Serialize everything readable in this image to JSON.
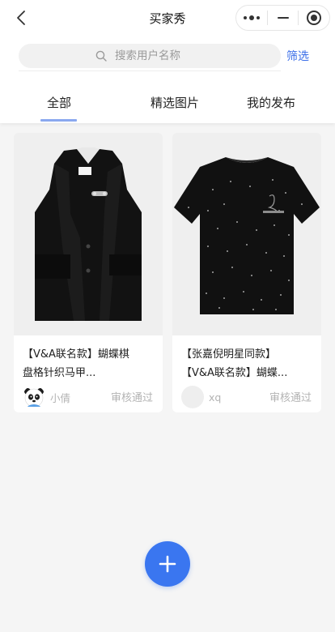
{
  "navbar": {
    "title": "买家秀",
    "back_icon": "chevron-left-icon",
    "capsule_icons": [
      "more-dots-icon",
      "minimize-icon",
      "close-target-icon"
    ]
  },
  "search": {
    "placeholder": "搜索用户名称",
    "icon": "search-icon",
    "filter_label": "筛选"
  },
  "tabs": [
    {
      "label": "全部",
      "active": true
    },
    {
      "label": "精选图片",
      "active": false
    },
    {
      "label": "我的发布",
      "active": false
    }
  ],
  "cards": [
    {
      "image": "black-sleeveless-vest-photo",
      "title_line1": "【V&A联名款】蝴蝶棋",
      "title_line2": "盘格针织马甲...",
      "user": "小倩",
      "avatar": "panda-avatar-icon",
      "status": "审核通过"
    },
    {
      "image": "black-studded-tshirt-photo",
      "title_line1": "【张嘉倪明星同款】",
      "title_line2": "【V&A联名款】蝴蝶...",
      "user": "xq",
      "avatar": "blank-avatar",
      "status": "审核通过"
    }
  ],
  "fab": {
    "icon": "plus-icon"
  },
  "colors": {
    "accent": "#3a6ee8",
    "fab": "#3a76f0",
    "tab_indicator": "#8aa8ef",
    "page_bg": "#f5f5f5",
    "muted_text": "#b3b3b3"
  }
}
